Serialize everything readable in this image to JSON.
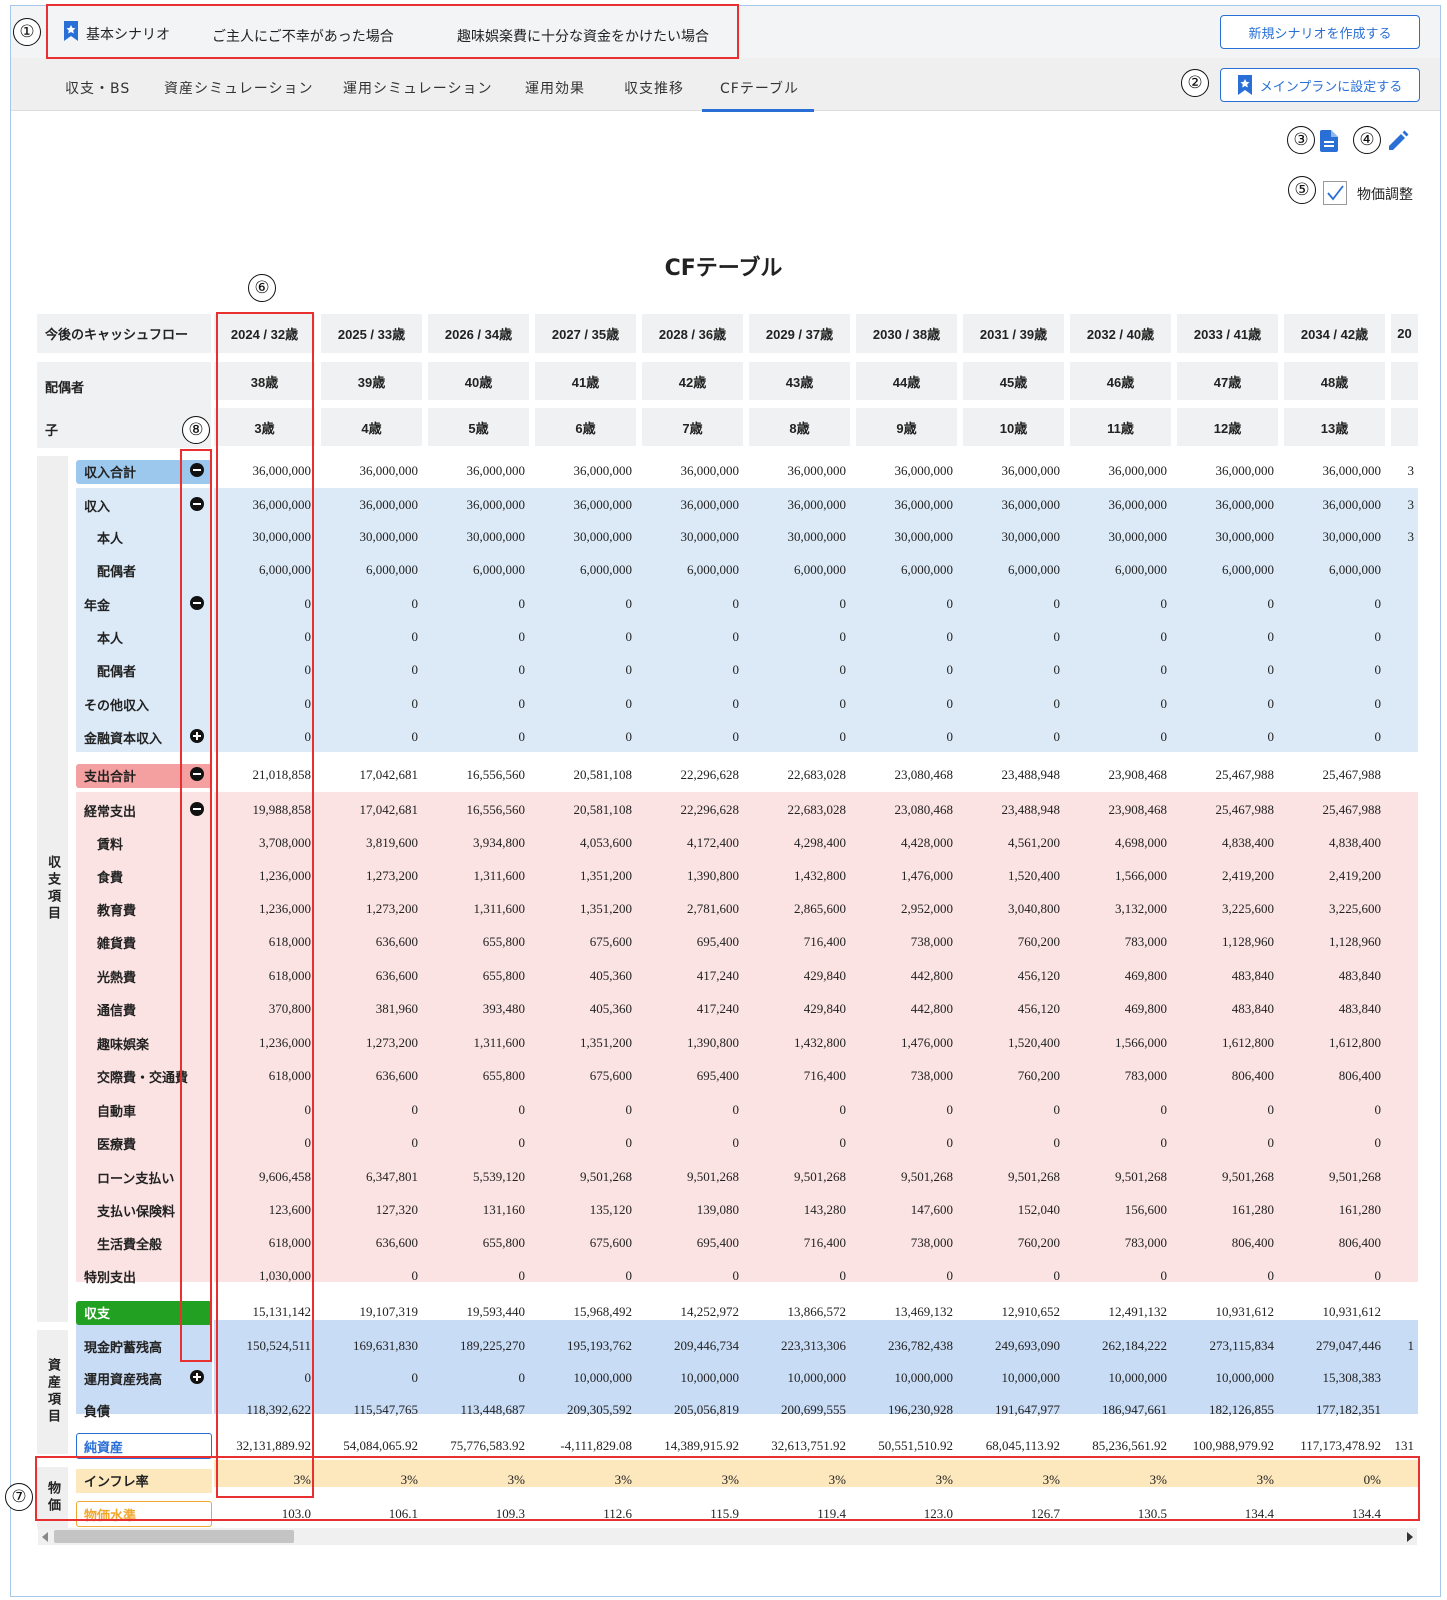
{
  "scenarios": {
    "items": [
      "基本シナリオ",
      "ご主人にご不幸があった場合",
      "趣味娯楽費に十分な資金をかけたい場合"
    ]
  },
  "toolbar": {
    "new_scenario_label": "新規シナリオを作成する",
    "main_plan_label": "メインプランに設定する",
    "price_adjust_label": "物価調整",
    "price_adjust_checked": true
  },
  "tabs": [
    "収支・BS",
    "資産シミュレーション",
    "運用シミュレーション",
    "運用効果",
    "収支推移",
    "CFテーブル"
  ],
  "active_tab": "CFテーブル",
  "markers": [
    "①",
    "②",
    "③",
    "④",
    "⑤",
    "⑥",
    "⑦",
    "⑧"
  ],
  "page_title": "CFテーブル",
  "table": {
    "header_label": "今後のキャッシュフロー",
    "years": [
      "2024 / 32歳",
      "2025 / 33歳",
      "2026 / 34歳",
      "2027 / 35歳",
      "2028 / 36歳",
      "2029 / 37歳",
      "2030 / 38歳",
      "2031 / 39歳",
      "2032 / 40歳",
      "2033 / 41歳",
      "2034 / 42歳",
      "20"
    ],
    "spouse_label": "配偶者",
    "spouse_ages": [
      "38歳",
      "39歳",
      "40歳",
      "41歳",
      "42歳",
      "43歳",
      "44歳",
      "45歳",
      "46歳",
      "47歳",
      "48歳"
    ],
    "child_label": "子",
    "child_ages": [
      "3歳",
      "4歳",
      "5歳",
      "6歳",
      "7歳",
      "8歳",
      "9歳",
      "10歳",
      "11歳",
      "12歳",
      "13歳"
    ],
    "section_cf": "収支項目",
    "section_asset": "資産項目",
    "section_price": "物価",
    "rows": [
      {
        "label": "収入合計",
        "values": [
          "36,000,000",
          "36,000,000",
          "36,000,000",
          "36,000,000",
          "36,000,000",
          "36,000,000",
          "36,000,000",
          "36,000,000",
          "36,000,000",
          "36,000,000",
          "36,000,000",
          "3"
        ]
      },
      {
        "label": "収入",
        "values": [
          "36,000,000",
          "36,000,000",
          "36,000,000",
          "36,000,000",
          "36,000,000",
          "36,000,000",
          "36,000,000",
          "36,000,000",
          "36,000,000",
          "36,000,000",
          "36,000,000",
          "3"
        ]
      },
      {
        "label": "本人",
        "values": [
          "30,000,000",
          "30,000,000",
          "30,000,000",
          "30,000,000",
          "30,000,000",
          "30,000,000",
          "30,000,000",
          "30,000,000",
          "30,000,000",
          "30,000,000",
          "30,000,000",
          "3"
        ]
      },
      {
        "label": "配偶者",
        "values": [
          "6,000,000",
          "6,000,000",
          "6,000,000",
          "6,000,000",
          "6,000,000",
          "6,000,000",
          "6,000,000",
          "6,000,000",
          "6,000,000",
          "6,000,000",
          "6,000,000",
          ""
        ]
      },
      {
        "label": "年金",
        "values": [
          "0",
          "0",
          "0",
          "0",
          "0",
          "0",
          "0",
          "0",
          "0",
          "0",
          "0",
          ""
        ]
      },
      {
        "label": "本人",
        "values": [
          "0",
          "0",
          "0",
          "0",
          "0",
          "0",
          "0",
          "0",
          "0",
          "0",
          "0",
          ""
        ]
      },
      {
        "label": "配偶者",
        "values": [
          "0",
          "0",
          "0",
          "0",
          "0",
          "0",
          "0",
          "0",
          "0",
          "0",
          "0",
          ""
        ]
      },
      {
        "label": "その他収入",
        "values": [
          "0",
          "0",
          "0",
          "0",
          "0",
          "0",
          "0",
          "0",
          "0",
          "0",
          "0",
          ""
        ]
      },
      {
        "label": "金融資本収入",
        "values": [
          "0",
          "0",
          "0",
          "0",
          "0",
          "0",
          "0",
          "0",
          "0",
          "0",
          "0",
          ""
        ]
      },
      {
        "label": "支出合計",
        "values": [
          "21,018,858",
          "17,042,681",
          "16,556,560",
          "20,581,108",
          "22,296,628",
          "22,683,028",
          "23,080,468",
          "23,488,948",
          "23,908,468",
          "25,467,988",
          "25,467,988",
          ""
        ]
      },
      {
        "label": "経常支出",
        "values": [
          "19,988,858",
          "17,042,681",
          "16,556,560",
          "20,581,108",
          "22,296,628",
          "22,683,028",
          "23,080,468",
          "23,488,948",
          "23,908,468",
          "25,467,988",
          "25,467,988",
          ""
        ]
      },
      {
        "label": "賃料",
        "values": [
          "3,708,000",
          "3,819,600",
          "3,934,800",
          "4,053,600",
          "4,172,400",
          "4,298,400",
          "4,428,000",
          "4,561,200",
          "4,698,000",
          "4,838,400",
          "4,838,400",
          ""
        ]
      },
      {
        "label": "食費",
        "values": [
          "1,236,000",
          "1,273,200",
          "1,311,600",
          "1,351,200",
          "1,390,800",
          "1,432,800",
          "1,476,000",
          "1,520,400",
          "1,566,000",
          "2,419,200",
          "2,419,200",
          ""
        ]
      },
      {
        "label": "教育費",
        "values": [
          "1,236,000",
          "1,273,200",
          "1,311,600",
          "1,351,200",
          "2,781,600",
          "2,865,600",
          "2,952,000",
          "3,040,800",
          "3,132,000",
          "3,225,600",
          "3,225,600",
          ""
        ]
      },
      {
        "label": "雑貨費",
        "values": [
          "618,000",
          "636,600",
          "655,800",
          "675,600",
          "695,400",
          "716,400",
          "738,000",
          "760,200",
          "783,000",
          "1,128,960",
          "1,128,960",
          ""
        ]
      },
      {
        "label": "光熱費",
        "values": [
          "618,000",
          "636,600",
          "655,800",
          "405,360",
          "417,240",
          "429,840",
          "442,800",
          "456,120",
          "469,800",
          "483,840",
          "483,840",
          ""
        ]
      },
      {
        "label": "通信費",
        "values": [
          "370,800",
          "381,960",
          "393,480",
          "405,360",
          "417,240",
          "429,840",
          "442,800",
          "456,120",
          "469,800",
          "483,840",
          "483,840",
          ""
        ]
      },
      {
        "label": "趣味娯楽",
        "values": [
          "1,236,000",
          "1,273,200",
          "1,311,600",
          "1,351,200",
          "1,390,800",
          "1,432,800",
          "1,476,000",
          "1,520,400",
          "1,566,000",
          "1,612,800",
          "1,612,800",
          ""
        ]
      },
      {
        "label": "交際費・交通費",
        "values": [
          "618,000",
          "636,600",
          "655,800",
          "675,600",
          "695,400",
          "716,400",
          "738,000",
          "760,200",
          "783,000",
          "806,400",
          "806,400",
          ""
        ]
      },
      {
        "label": "自動車",
        "values": [
          "0",
          "0",
          "0",
          "0",
          "0",
          "0",
          "0",
          "0",
          "0",
          "0",
          "0",
          ""
        ]
      },
      {
        "label": "医療費",
        "values": [
          "0",
          "0",
          "0",
          "0",
          "0",
          "0",
          "0",
          "0",
          "0",
          "0",
          "0",
          ""
        ]
      },
      {
        "label": "ローン支払い",
        "values": [
          "9,606,458",
          "6,347,801",
          "5,539,120",
          "9,501,268",
          "9,501,268",
          "9,501,268",
          "9,501,268",
          "9,501,268",
          "9,501,268",
          "9,501,268",
          "9,501,268",
          ""
        ]
      },
      {
        "label": "支払い保険料",
        "values": [
          "123,600",
          "127,320",
          "131,160",
          "135,120",
          "139,080",
          "143,280",
          "147,600",
          "152,040",
          "156,600",
          "161,280",
          "161,280",
          ""
        ]
      },
      {
        "label": "生活費全般",
        "values": [
          "618,000",
          "636,600",
          "655,800",
          "675,600",
          "695,400",
          "716,400",
          "738,000",
          "760,200",
          "783,000",
          "806,400",
          "806,400",
          ""
        ]
      },
      {
        "label": "特別支出",
        "values": [
          "1,030,000",
          "0",
          "0",
          "0",
          "0",
          "0",
          "0",
          "0",
          "0",
          "0",
          "0",
          ""
        ]
      },
      {
        "label": "収支",
        "values": [
          "15,131,142",
          "19,107,319",
          "19,593,440",
          "15,968,492",
          "14,252,972",
          "13,866,572",
          "13,469,132",
          "12,910,652",
          "12,491,132",
          "10,931,612",
          "10,931,612",
          ""
        ]
      },
      {
        "label": "現金貯蓄残高",
        "values": [
          "150,524,511",
          "169,631,830",
          "189,225,270",
          "195,193,762",
          "209,446,734",
          "223,313,306",
          "236,782,438",
          "249,693,090",
          "262,184,222",
          "273,115,834",
          "279,047,446",
          "1"
        ]
      },
      {
        "label": "運用資産残高",
        "values": [
          "0",
          "0",
          "0",
          "10,000,000",
          "10,000,000",
          "10,000,000",
          "10,000,000",
          "10,000,000",
          "10,000,000",
          "10,000,000",
          "15,308,383",
          ""
        ]
      },
      {
        "label": "負債",
        "values": [
          "118,392,622",
          "115,547,765",
          "113,448,687",
          "209,305,592",
          "205,056,819",
          "200,699,555",
          "196,230,928",
          "191,647,977",
          "186,947,661",
          "182,126,855",
          "177,182,351",
          ""
        ]
      },
      {
        "label": "純資産",
        "values": [
          "32,131,889.92",
          "54,084,065.92",
          "75,776,583.92",
          "-4,111,829.08",
          "14,389,915.92",
          "32,613,751.92",
          "50,551,510.92",
          "68,045,113.92",
          "85,236,561.92",
          "100,988,979.92",
          "117,173,478.92",
          "131"
        ]
      },
      {
        "label": "インフレ率",
        "values": [
          "3%",
          "3%",
          "3%",
          "3%",
          "3%",
          "3%",
          "3%",
          "3%",
          "3%",
          "3%",
          "0%",
          ""
        ]
      },
      {
        "label": "物価水準",
        "values": [
          "103.0",
          "106.1",
          "109.3",
          "112.6",
          "115.9",
          "119.4",
          "123.0",
          "126.7",
          "130.5",
          "134.4",
          "134.4",
          ""
        ]
      }
    ]
  },
  "colors": {
    "accent": "#2a6fd6",
    "income_bg": "#dceaf8",
    "expense_bg": "#fbe3e3",
    "asset_bg": "#c9dcf5",
    "price_bg": "#fde8bd",
    "balance_tag": "#22a022",
    "highlight": "#e83030"
  }
}
